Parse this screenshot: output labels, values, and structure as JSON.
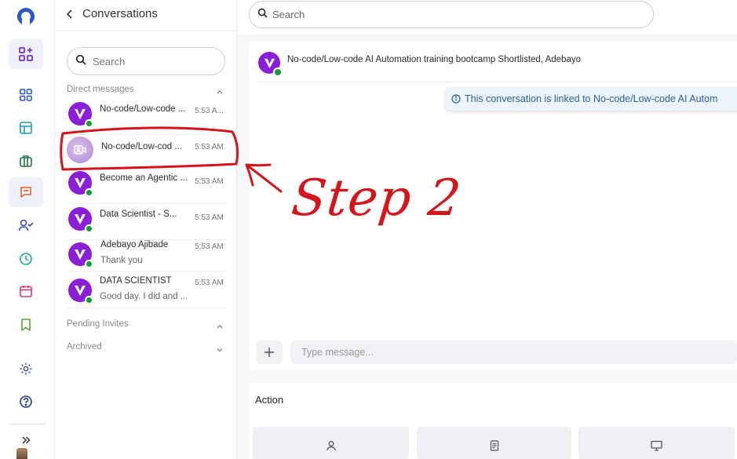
{
  "panel": {
    "title": "Conversations",
    "search_placeholder": "Search",
    "direct_messages_label": "Direct messages",
    "pending_invites_label": "Pending Invites",
    "archived_label": "Archived"
  },
  "conversations": [
    {
      "name": "No-code/Low-code ...",
      "time": "5:53 A...",
      "preview": "",
      "avatar": "brand-logo"
    },
    {
      "name": "No-code/Low-cod ...",
      "time": "5:53 AM",
      "preview": "",
      "avatar": "video-placeholder"
    },
    {
      "name": "Become an Agentic ...",
      "time": "5:53 AM",
      "preview": "",
      "avatar": "brand-logo"
    },
    {
      "name": "Data Scientist - S...",
      "time": "5:53 AM",
      "preview": "",
      "avatar": "brand-logo"
    },
    {
      "name": "Adebayo Ajibade",
      "time": "5:53 AM",
      "preview": "Thank you",
      "avatar": "brand-logo"
    },
    {
      "name": "DATA SCIENTIST",
      "time": "5:53 AM",
      "preview": "Good day. I did and ...",
      "avatar": "brand-logo"
    }
  ],
  "main": {
    "search_placeholder": "Search",
    "chat_title": "No-code/Low-code AI Automation training bootcamp Shortlisted, Adebayo",
    "linked_note": "This conversation is linked to No-code/Low-code AI Autom",
    "composer_placeholder": "Type message...",
    "action_title": "Action"
  },
  "annotation": {
    "step_label": "Step 2"
  },
  "colors": {
    "brand_purple": "#8b1fd6",
    "online_green": "#159a3c",
    "annotation_red": "#d4161c",
    "link_blue": "#2b5d9c"
  }
}
